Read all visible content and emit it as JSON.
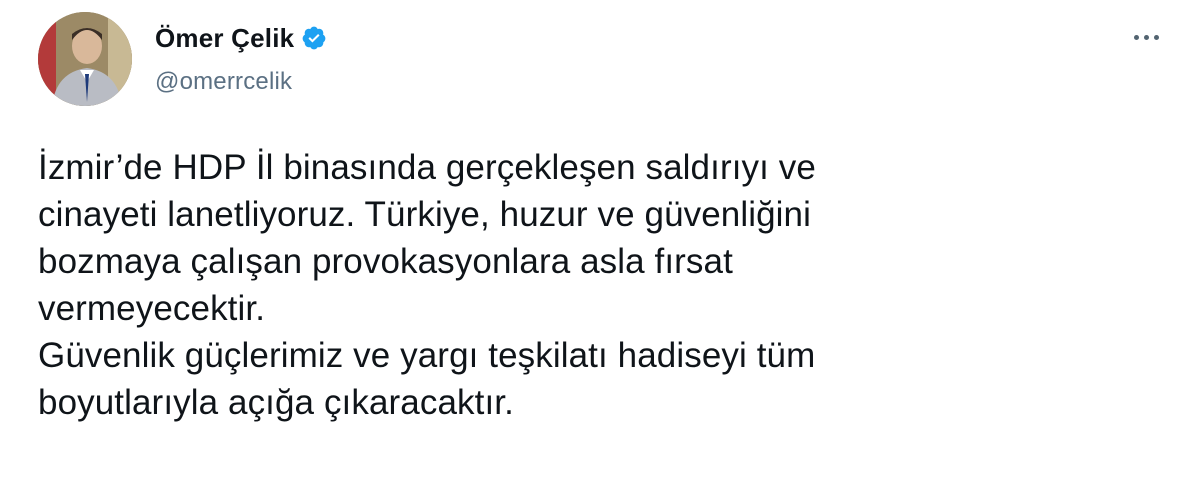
{
  "tweet": {
    "author": {
      "display_name": "Ömer Çelik",
      "handle": "@omerrcelik",
      "verified": true,
      "verified_color": "#1da1f2"
    },
    "more_icon": "more-horizontal-icon",
    "text_lines": [
      "İzmir’de HDP İl binasında gerçekleşen saldırıyı ve",
      "cinayeti lanetliyoruz. Türkiye, huzur ve güvenliğini",
      "bozmaya çalışan provokasyonlara asla fırsat",
      "vermeyecektir.",
      "Güvenlik güçlerimiz ve yargı teşkilatı hadiseyi tüm",
      "boyutlarıyla açığa çıkaracaktır."
    ]
  }
}
